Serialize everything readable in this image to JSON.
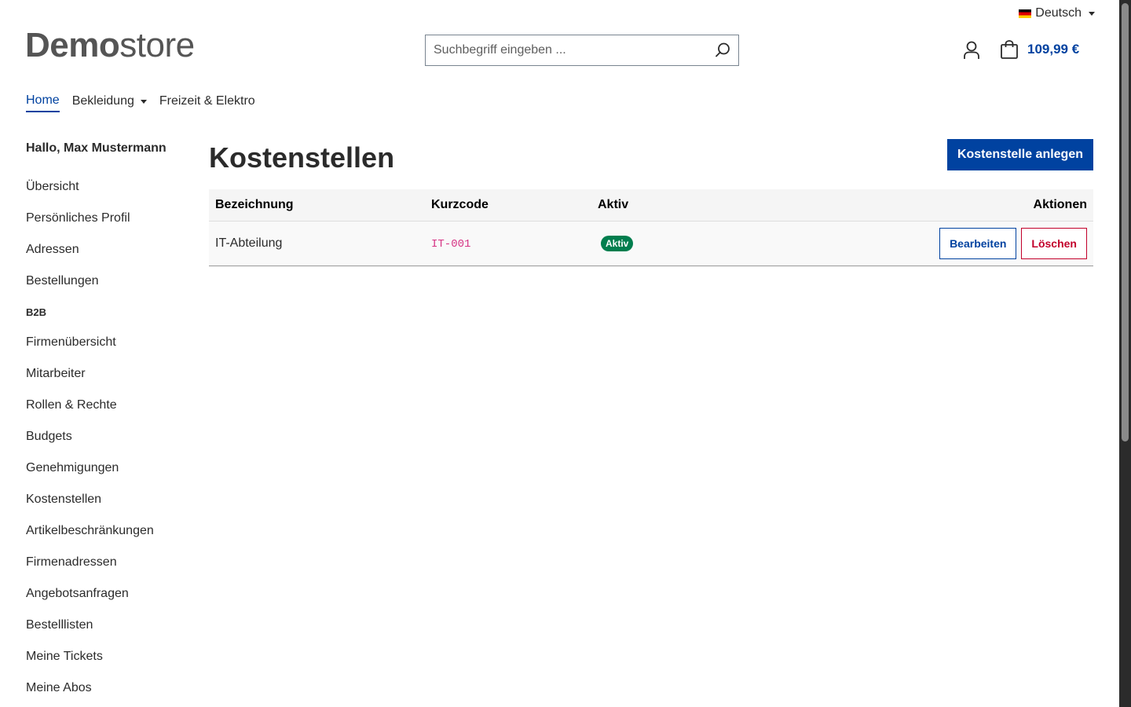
{
  "header": {
    "language": "Deutsch",
    "logo": {
      "bold": "Demo",
      "light": "store"
    },
    "search_placeholder": "Suchbegriff eingeben ...",
    "cart_total": "109,99 €"
  },
  "nav": {
    "items": [
      {
        "label": "Home",
        "active": true
      },
      {
        "label": "Bekleidung",
        "dropdown": true
      },
      {
        "label": "Freizeit & Elektro"
      }
    ]
  },
  "sidebar": {
    "greeting": "Hallo, Max Mustermann",
    "items": [
      "Übersicht",
      "Persönliches Profil",
      "Adressen",
      "Bestellungen"
    ],
    "section_label": "B2B",
    "b2b_items": [
      "Firmenübersicht",
      "Mitarbeiter",
      "Rollen & Rechte",
      "Budgets",
      "Genehmigungen",
      "Kostenstellen",
      "Artikelbeschränkungen",
      "Firmenadressen",
      "Angebotsanfragen",
      "Bestelllisten",
      "Meine Tickets",
      "Meine Abos"
    ]
  },
  "main": {
    "title": "Kostenstellen",
    "create_button": "Kostenstelle anlegen",
    "table": {
      "headers": [
        "Bezeichnung",
        "Kurzcode",
        "Aktiv",
        "Aktionen"
      ],
      "rows": [
        {
          "name": "IT-Abteilung",
          "code": "IT-001",
          "status": "Aktiv"
        }
      ]
    },
    "edit_label": "Bearbeiten",
    "delete_label": "Löschen"
  },
  "colors": {
    "primary": "#0042a0",
    "danger": "#c2002b",
    "success": "#007e4e",
    "code": "#d63384"
  }
}
